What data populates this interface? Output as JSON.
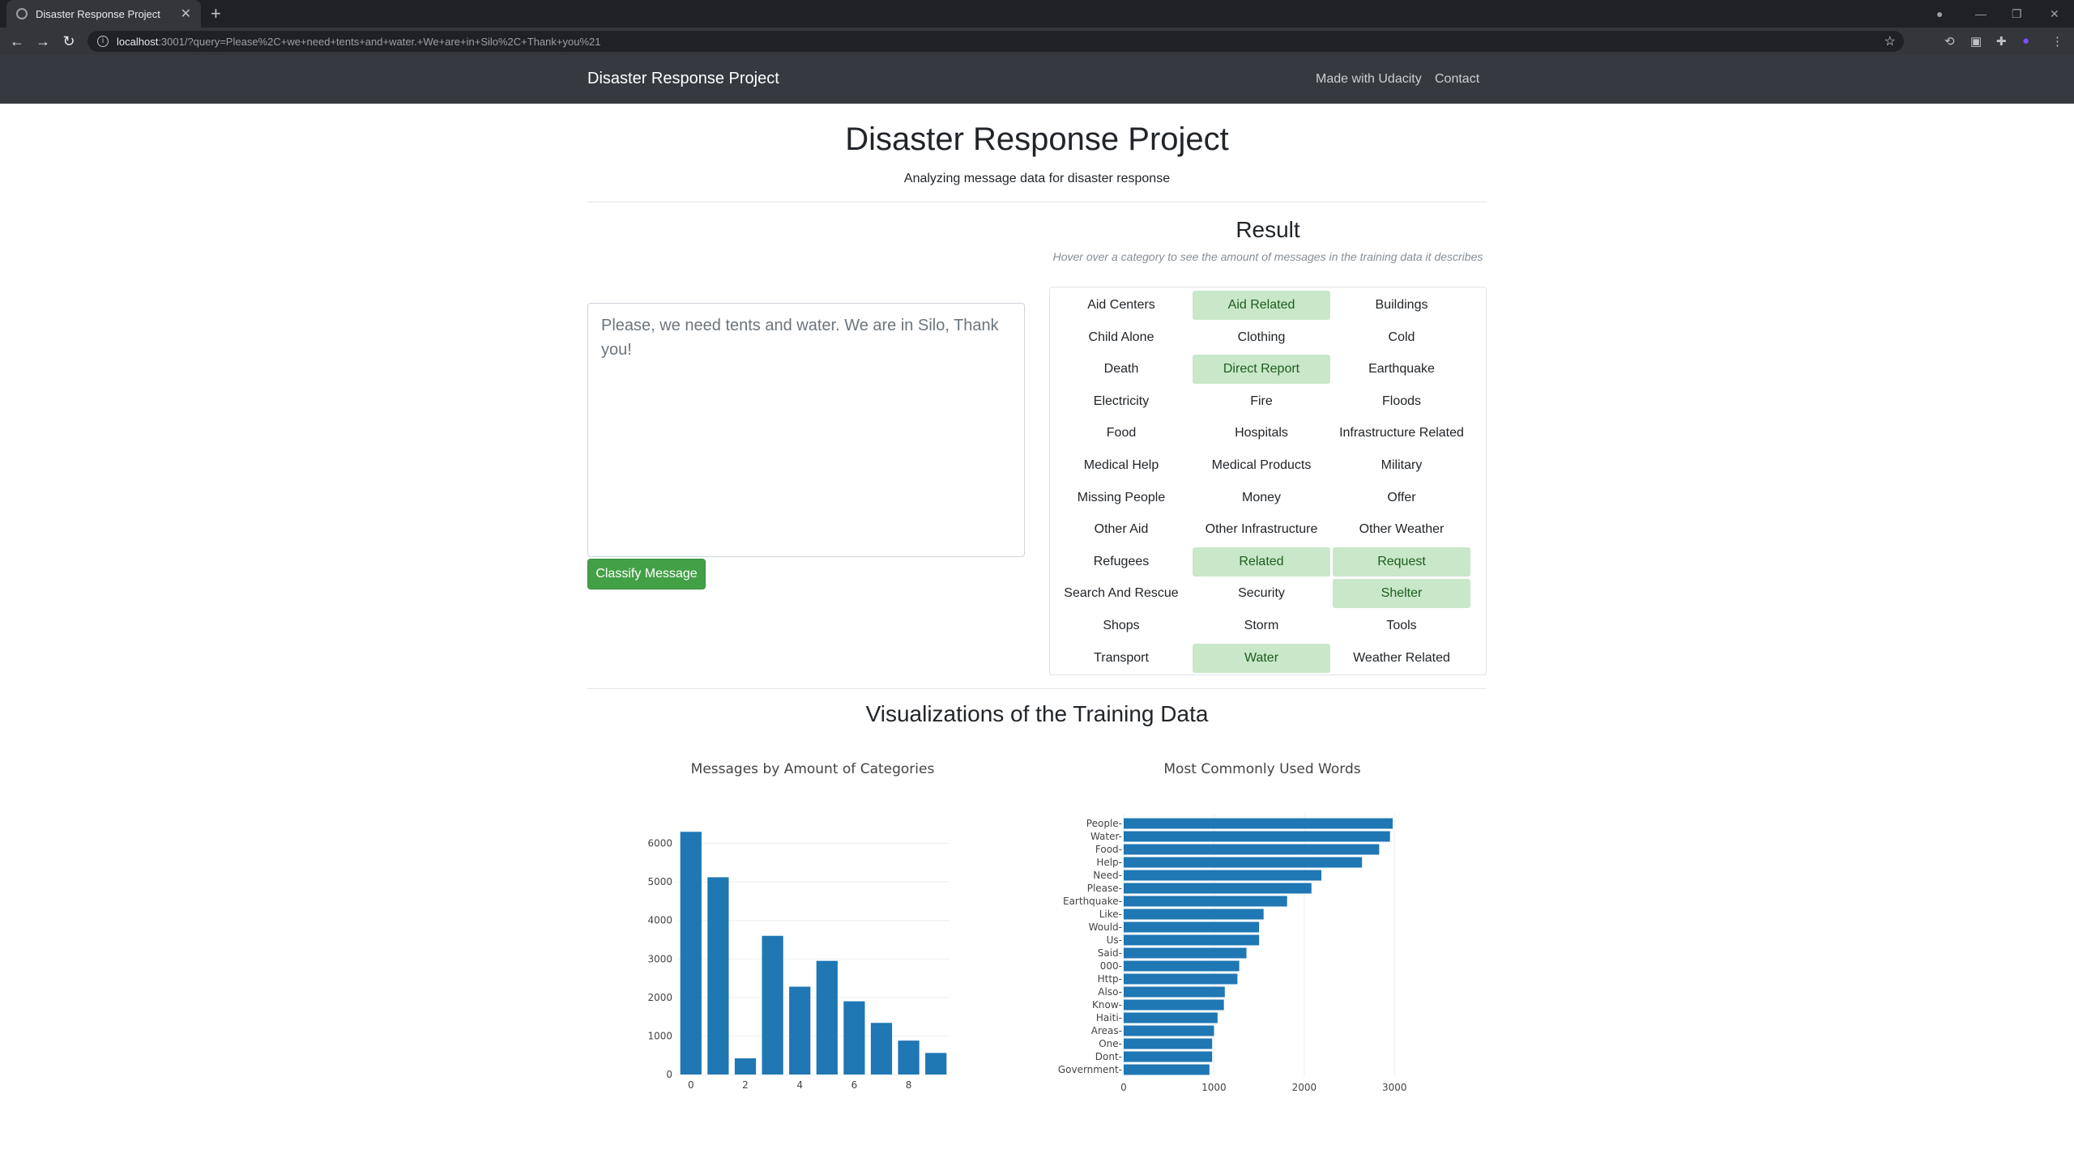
{
  "browser": {
    "tab_title": "Disaster Response Project",
    "url_host": "localhost",
    "url_rest": ":3001/?query=Please%2C+we+need+tents+and+water.+We+are+in+Silo%2C+Thank+you%21"
  },
  "navbar": {
    "brand": "Disaster Response Project",
    "links": [
      "Made with Udacity",
      "Contact"
    ]
  },
  "header": {
    "title": "Disaster Response Project",
    "subtitle": "Analyzing message data for disaster response"
  },
  "form": {
    "message": "Please, we need tents and water. We are in Silo, Thank you!",
    "button": "Classify Message"
  },
  "result": {
    "title": "Result",
    "hint": "Hover over a category to see the amount of messages in the training data it describes",
    "highlight_color": "#c9e7c9",
    "categories": [
      {
        "label": "Aid Centers",
        "on": false
      },
      {
        "label": "Aid Related",
        "on": true
      },
      {
        "label": "Buildings",
        "on": false
      },
      {
        "label": "Child Alone",
        "on": false
      },
      {
        "label": "Clothing",
        "on": false
      },
      {
        "label": "Cold",
        "on": false
      },
      {
        "label": "Death",
        "on": false
      },
      {
        "label": "Direct Report",
        "on": true
      },
      {
        "label": "Earthquake",
        "on": false
      },
      {
        "label": "Electricity",
        "on": false
      },
      {
        "label": "Fire",
        "on": false
      },
      {
        "label": "Floods",
        "on": false
      },
      {
        "label": "Food",
        "on": false
      },
      {
        "label": "Hospitals",
        "on": false
      },
      {
        "label": "Infrastructure Related",
        "on": false
      },
      {
        "label": "Medical Help",
        "on": false
      },
      {
        "label": "Medical Products",
        "on": false
      },
      {
        "label": "Military",
        "on": false
      },
      {
        "label": "Missing People",
        "on": false
      },
      {
        "label": "Money",
        "on": false
      },
      {
        "label": "Offer",
        "on": false
      },
      {
        "label": "Other Aid",
        "on": false
      },
      {
        "label": "Other Infrastructure",
        "on": false
      },
      {
        "label": "Other Weather",
        "on": false
      },
      {
        "label": "Refugees",
        "on": false
      },
      {
        "label": "Related",
        "on": true
      },
      {
        "label": "Request",
        "on": true
      },
      {
        "label": "Search And Rescue",
        "on": false
      },
      {
        "label": "Security",
        "on": false
      },
      {
        "label": "Shelter",
        "on": true
      },
      {
        "label": "Shops",
        "on": false
      },
      {
        "label": "Storm",
        "on": false
      },
      {
        "label": "Tools",
        "on": false
      },
      {
        "label": "Transport",
        "on": false
      },
      {
        "label": "Water",
        "on": true
      },
      {
        "label": "Weather Related",
        "on": false
      }
    ]
  },
  "viz": {
    "title": "Visualizations of the Training Data"
  },
  "chart_data": [
    {
      "type": "bar",
      "title": "Messages by Amount of Categories",
      "x": [
        0,
        1,
        2,
        3,
        4,
        5,
        6,
        7,
        8,
        9
      ],
      "values": [
        6300,
        5120,
        420,
        3600,
        2280,
        2950,
        1900,
        1340,
        880,
        560
      ],
      "xticks": [
        0,
        2,
        4,
        6,
        8
      ],
      "yticks": [
        0,
        1000,
        2000,
        3000,
        4000,
        5000,
        6000
      ],
      "ylim": [
        0,
        6600
      ],
      "color": "#1f77b4",
      "grid": true
    },
    {
      "type": "bar",
      "orientation": "horizontal",
      "title": "Most Commonly Used Words",
      "categories": [
        "People",
        "Water",
        "Food",
        "Help",
        "Need",
        "Please",
        "Earthquake",
        "Like",
        "Would",
        "Us",
        "Said",
        "000",
        "Http",
        "Also",
        "Know",
        "Haiti",
        "Areas",
        "One",
        "Dont",
        "Government"
      ],
      "values": [
        2980,
        2950,
        2830,
        2640,
        2190,
        2080,
        1810,
        1550,
        1500,
        1500,
        1360,
        1280,
        1260,
        1120,
        1110,
        1040,
        1000,
        980,
        980,
        950
      ],
      "xticks": [
        0,
        1000,
        2000,
        3000
      ],
      "xlim": [
        0,
        3150
      ],
      "color": "#1f77b4",
      "grid": true
    }
  ]
}
